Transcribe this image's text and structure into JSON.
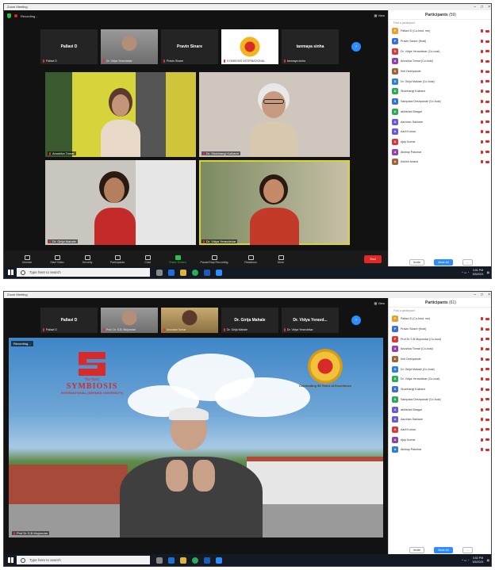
{
  "shot1": {
    "title": "Zoom Meeting",
    "recording_label": "Recording...",
    "view_label": "View",
    "strip": [
      {
        "name": "Pallavi D",
        "caption": "Pallavi D"
      },
      {
        "name": "",
        "caption": "Dr. Vidya Yeravdekar"
      },
      {
        "name": "Pravin Sinare",
        "caption": "Pravin Sinare"
      },
      {
        "name": "",
        "caption": "SYMBIOSIS INTERNATIONAL"
      },
      {
        "name": "tanmaya sinha",
        "caption": "tanmaya sinha"
      }
    ],
    "gallery": [
      {
        "caption": "Anushka Tomar"
      },
      {
        "caption": "Dr. Shubhangi Kulkarni"
      },
      {
        "caption": "Dr. Girija Mahale"
      },
      {
        "caption": "Dr. Vidya Yeravdekar"
      }
    ],
    "toolbar": [
      {
        "label": "Unmute",
        "icon": "microphone-icon"
      },
      {
        "label": "Start Video",
        "icon": "video-icon"
      },
      {
        "label": "Security",
        "icon": "shield-icon"
      },
      {
        "label": "Participants",
        "icon": "participants-icon"
      },
      {
        "label": "Chat",
        "icon": "chat-icon"
      },
      {
        "label": "Share Screen",
        "icon": "share-screen-icon"
      },
      {
        "label": "Pause/Stop Recording",
        "icon": "record-icon"
      },
      {
        "label": "Reactions",
        "icon": "reactions-icon"
      },
      {
        "label": "More",
        "icon": "more-icon"
      }
    ],
    "end_label": "End",
    "panel": {
      "title": "Participants",
      "count": "(59)",
      "search": "Find a participant",
      "participants": [
        {
          "initial": "P",
          "name": "Pallavi D (Co-host, me)",
          "color": "#e8a030"
        },
        {
          "initial": "P",
          "name": "Pravin Sinare (Host)",
          "color": "#3f6fd6"
        },
        {
          "initial": "D",
          "name": "Dr. Vidya Yeravdekar (Co-host)",
          "color": "#d63a3a"
        },
        {
          "initial": "A",
          "name": "Anushka Tomar (Co-host)",
          "color": "#8e44ad"
        },
        {
          "initial": "K",
          "name": "Kirti Deshpande",
          "color": "#a0643a"
        },
        {
          "initial": "D",
          "name": "Dr. Girija Mahale (Co-host)",
          "color": "#2f7fd6"
        },
        {
          "initial": "D",
          "name": "Shubhangi Kulkarni",
          "color": "#2fa85a"
        },
        {
          "initial": "S",
          "name": "Sampada Deshpande (Co-host)",
          "color": "#3a6fd6"
        },
        {
          "initial": "A",
          "name": "abhishek Bhagat",
          "color": "#2fa85a"
        },
        {
          "initial": "A",
          "name": "Aarohan Sakhare",
          "color": "#6a5ad6"
        },
        {
          "initial": "A",
          "name": "Aarti Kumar",
          "color": "#6a5ad6"
        },
        {
          "initial": "A",
          "name": "Ajay Kumar",
          "color": "#d63a3a"
        },
        {
          "initial": "A",
          "name": "Akshay Paturkar",
          "color": "#8e44ad"
        },
        {
          "initial": "A",
          "name": "Ashish Anand",
          "color": "#a0643a"
        }
      ],
      "invite_label": "Invite",
      "mute_all_label": "Mute All",
      "more_label": "..."
    },
    "taskbar": {
      "search": "Type here to search",
      "time": "3:51 PM",
      "date": "5/5/2021"
    }
  },
  "shot2": {
    "title": "Zoom Meeting",
    "view_label": "View",
    "strip": [
      {
        "name": "Pallavi D",
        "caption": "Pallavi D"
      },
      {
        "name": "",
        "caption": "Prof. Dr. S.B. Mujumdar"
      },
      {
        "name": "",
        "caption": "Anushka Tomar"
      },
      {
        "name": "Dr. Girija Mahale",
        "caption": "Dr. Girija Mahale"
      },
      {
        "name": "Dr. Vidya Yeravd...",
        "caption": "Dr. Vidya Yeravdekar"
      }
    ],
    "recording_label": "Recording...",
    "speaker": {
      "caption": "Prof Dr S.B Mujumdar",
      "logo_small": "विद्या विश्वम्",
      "logo_name": "SYMBIOSIS",
      "logo_sub": "INTERNATIONAL (DEEMED UNIVERSITY)",
      "medal_text": "Celebrating 50 Years of Excellence"
    },
    "panel": {
      "title": "Participants",
      "count": "(61)",
      "search": "Find a participant",
      "participants": [
        {
          "initial": "P",
          "name": "Pallavi D (Co-host, me)",
          "color": "#e8a030"
        },
        {
          "initial": "P",
          "name": "Pravin Sinare (Host)",
          "color": "#3f6fd6"
        },
        {
          "initial": "P",
          "name": "Prof Dr S.B Mujumdar (Co-host)",
          "color": "#d63a3a"
        },
        {
          "initial": "A",
          "name": "Anushka Tomar (Co-host)",
          "color": "#8e44ad"
        },
        {
          "initial": "K",
          "name": "Kirti Deshpande",
          "color": "#a0643a"
        },
        {
          "initial": "D",
          "name": "Dr. Girija Mahale (Co-host)",
          "color": "#2f7fd6"
        },
        {
          "initial": "D",
          "name": "Dr. Vidya Yeravdekar (Co-host)",
          "color": "#2fa85a"
        },
        {
          "initial": "S",
          "name": "Shubhangi Kulkarni",
          "color": "#3a6fd6"
        },
        {
          "initial": "S",
          "name": "Sampada Deshpande (Co-host)",
          "color": "#2fa85a"
        },
        {
          "initial": "A",
          "name": "abhishek Bhagat",
          "color": "#6a5ad6"
        },
        {
          "initial": "A",
          "name": "Aarohan Sakhare",
          "color": "#6a5ad6"
        },
        {
          "initial": "A",
          "name": "Aarti Kumar",
          "color": "#d63a3a"
        },
        {
          "initial": "A",
          "name": "Ajay Kumar",
          "color": "#8e44ad"
        },
        {
          "initial": "A",
          "name": "Akshay Paturkar",
          "color": "#2f7fd6"
        }
      ],
      "invite_label": "Invite",
      "mute_all_label": "Mute All",
      "more_label": "..."
    },
    "taskbar": {
      "search": "Type here to search",
      "time": "3:52 PM",
      "date": "5/5/2021"
    }
  }
}
